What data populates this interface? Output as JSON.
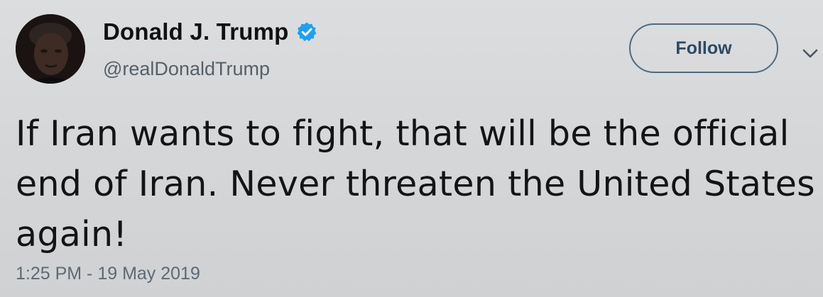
{
  "user": {
    "display_name": "Donald J. Trump",
    "handle": "@realDonaldTrump",
    "verified": true,
    "verified_color": "#1da1f2"
  },
  "actions": {
    "follow_label": "Follow"
  },
  "tweet": {
    "text": "If Iran wants to fight, that will be the official\nend of Iran. Never threaten the United States\nagain!",
    "timestamp": "1:25 PM - 19 May 2019"
  },
  "icons": {
    "verified": "verified-badge-icon",
    "menu": "chevron-down-icon"
  }
}
